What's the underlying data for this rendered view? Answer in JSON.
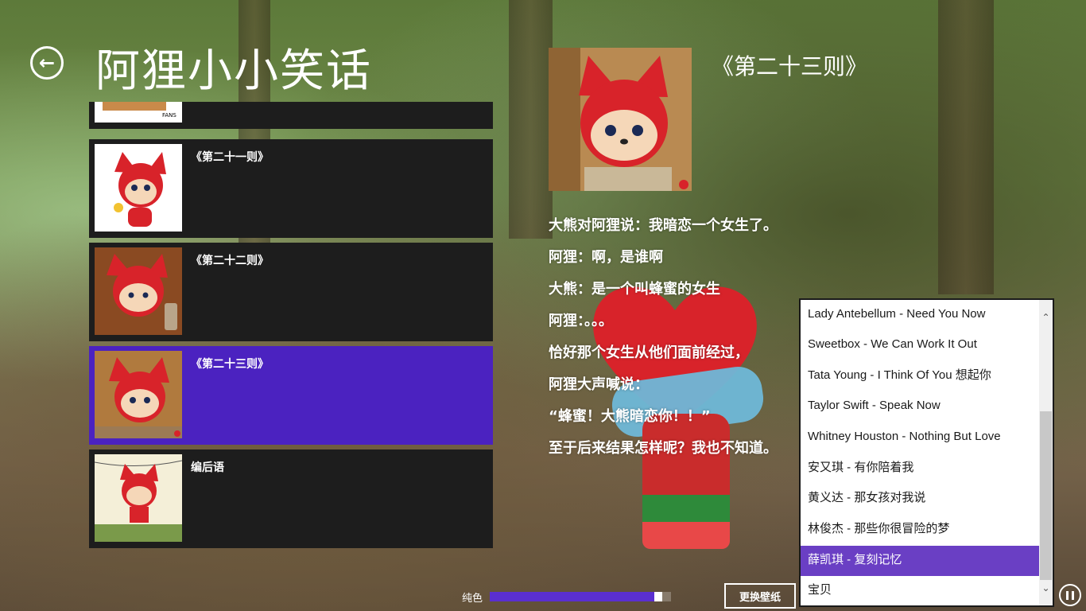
{
  "header": {
    "title": "阿狸小小笑话"
  },
  "list": {
    "items": [
      {
        "title": ""
      },
      {
        "title": "《第二十一则》"
      },
      {
        "title": "《第二十二则》"
      },
      {
        "title": "《第二十三则》",
        "selected": true
      },
      {
        "title": "编后语"
      }
    ]
  },
  "detail": {
    "heading": "《第二十三则》",
    "lines": [
      "大熊对阿狸说：我暗恋一个女生了。",
      "阿狸：啊，是谁啊",
      "大熊：是一个叫蜂蜜的女生",
      "阿狸：。。。",
      "恰好那个女生从他们面前经过，",
      "阿狸大声喊说：",
      "“蜂蜜！大熊暗恋你！！”",
      "至于后来结果怎样呢？我也不知道。"
    ]
  },
  "playlist": {
    "items": [
      "Lady Antebellum - Need You Now",
      "Sweetbox - We Can Work It Out",
      "Tata Young - I Think Of You 想起你",
      "Taylor Swift - Speak Now",
      "Whitney Houston - Nothing But Love",
      "安又琪 - 有你陪着我",
      "黄义达 - 那女孩对我说",
      "林俊杰 - 那些你很冒险的梦",
      "薛凯琪 - 复刻记忆",
      "宝贝"
    ],
    "selected_index": 8
  },
  "bottom": {
    "color_label": "纯色",
    "slider_value": 0.95,
    "wallpaper_button": "更换壁纸"
  },
  "colors": {
    "accent": "#4b22c0",
    "list_bg": "#1d1d1d",
    "playlist_selected": "#6a3fc4"
  }
}
